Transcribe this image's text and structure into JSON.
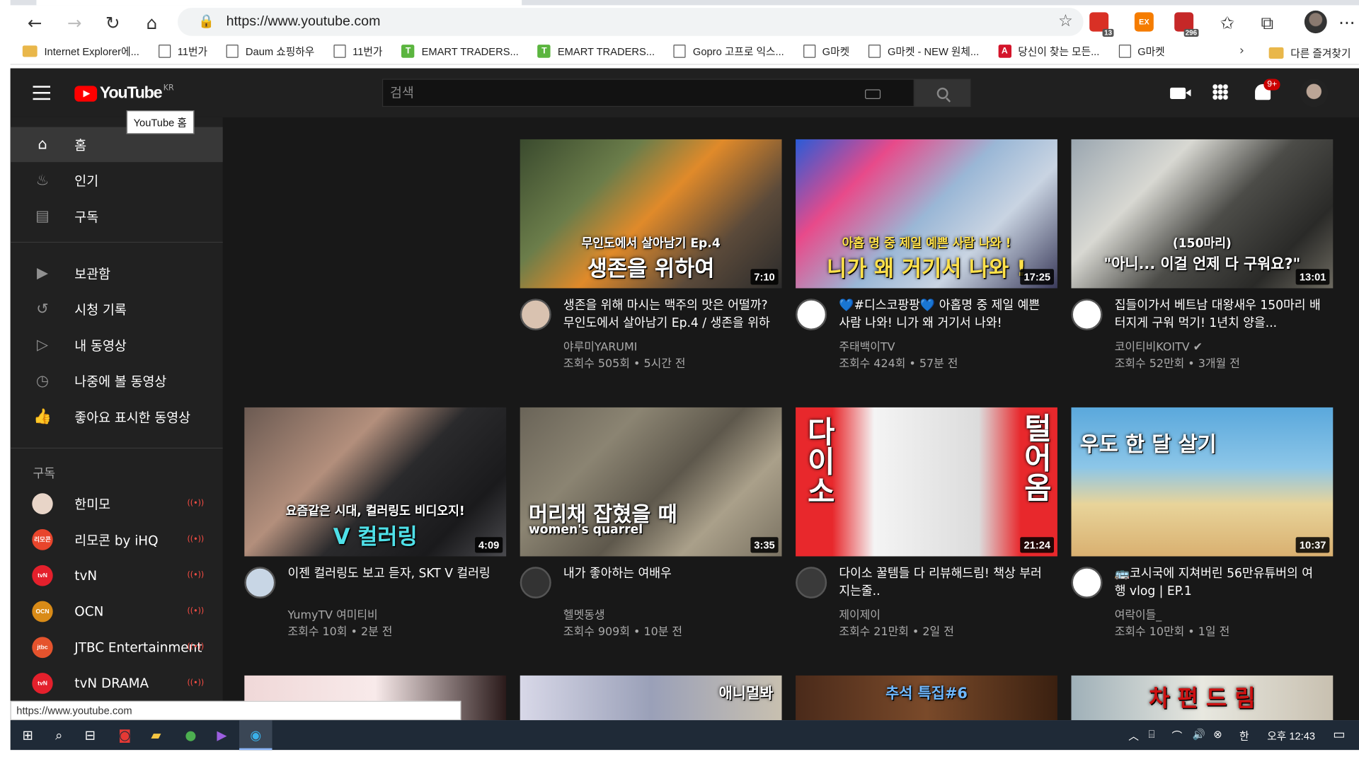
{
  "browser": {
    "url": "https://www.youtube.com",
    "status_url": "https://www.youtube.com",
    "extensions": [
      {
        "name": "adblock-icon",
        "badge": "13",
        "color": "#d93025",
        "label": ""
      },
      {
        "name": "ex-extension-icon",
        "badge": "",
        "color": "#f57c00",
        "label": "EX"
      },
      {
        "name": "calendar-extension-icon",
        "badge": "296",
        "color": "#c62828",
        "label": ""
      }
    ],
    "more_label": "···",
    "bookmarks": [
      {
        "label": "Internet Explorer에...",
        "icon": "folder"
      },
      {
        "label": "11번가",
        "icon": "page"
      },
      {
        "label": "Daum 쇼핑하우",
        "icon": "page"
      },
      {
        "label": "11번가",
        "icon": "page"
      },
      {
        "label": "EMART TRADERS...",
        "icon": "green"
      },
      {
        "label": "EMART TRADERS...",
        "icon": "green"
      },
      {
        "label": "Gopro 고프로 익스...",
        "icon": "page"
      },
      {
        "label": "G마켓",
        "icon": "page"
      },
      {
        "label": "G마켓 - NEW 원체...",
        "icon": "page"
      },
      {
        "label": "당신이 찾는 모든...",
        "icon": "red"
      },
      {
        "label": "G마켓",
        "icon": "page"
      }
    ],
    "other_bookmarks": "다른 즐겨찾기"
  },
  "youtube": {
    "logo_text": "YouTube",
    "logo_region": "KR",
    "tooltip": "YouTube 홈",
    "search_placeholder": "검색",
    "notification_badge": "9+",
    "sidebar": {
      "main": [
        {
          "label": "홈",
          "icon": "home-icon",
          "glyph": "⌂",
          "active": true
        },
        {
          "label": "인기",
          "icon": "fire-icon",
          "glyph": "♨",
          "active": false
        },
        {
          "label": "구독",
          "icon": "subscriptions-icon",
          "glyph": "▤",
          "active": false
        }
      ],
      "library": [
        {
          "label": "보관함",
          "icon": "library-icon",
          "glyph": "▶"
        },
        {
          "label": "시청 기록",
          "icon": "history-icon",
          "glyph": "↺"
        },
        {
          "label": "내 동영상",
          "icon": "my-videos-icon",
          "glyph": "▷"
        },
        {
          "label": "나중에 볼 동영상",
          "icon": "watch-later-icon",
          "glyph": "◷"
        },
        {
          "label": "좋아요 표시한 동영상",
          "icon": "thumbs-up-icon",
          "glyph": "👍"
        }
      ],
      "subs_title": "구독",
      "subscriptions": [
        {
          "label": "한미모",
          "color": "#e8d5c8",
          "initials": ""
        },
        {
          "label": "리모콘 by iHQ",
          "color": "#e8452c",
          "initials": "리모콘"
        },
        {
          "label": "tvN",
          "color": "#e4202c",
          "initials": "tvN"
        },
        {
          "label": "OCN",
          "color": "#d98b17",
          "initials": "OCN"
        },
        {
          "label": "JTBC Entertainment",
          "color": "#e5532d",
          "initials": "jtbc"
        },
        {
          "label": "tvN DRAMA",
          "color": "#e4202c",
          "initials": "tvN"
        }
      ]
    },
    "videos": [
      {
        "title": "생존을 위해 마시는 맥주의 맛은 어떨까? 무인도에서 살아남기 Ep.4 / 생존을 위하여",
        "channel": "야루미YARUMI",
        "meta": "조회수 505회 • 5시간 전",
        "duration": "7:10",
        "cap_small": "무인도에서 살아남기 Ep.4",
        "cap_big": "생존을 위하여",
        "cap_color": "#ffffff",
        "bg": "linear-gradient(135deg,#3a4a2e 0%,#6b7d4a 30%,#e08a2a 50%,#5b4a3a 75%,#2b2b2b 100%)",
        "avatar": "#d9c2b0",
        "verified": false
      },
      {
        "title": "💙#디스코팡팡💙 아홉명 중 제일 예쁜 사람 나와! 니가 왜 거기서 나와!",
        "channel": "주태백이TV",
        "meta": "조회수 424회 • 57분 전",
        "duration": "17:25",
        "cap_small": "아홉 명 중 제일 예쁜 사람 나와 !",
        "cap_big": "니가 왜 거기서 나와 !",
        "cap_color": "#ffe14a",
        "bg": "linear-gradient(135deg,#2a5bd7 0%,#e84a8a 25%,#9ab7d6 50%,#c9d4e2 70%,#3a3a5a 100%)",
        "avatar": "#ffffff",
        "verified": false
      },
      {
        "title": "집들이가서 베트남 대왕새우 150마리 배터지게 구워 먹기! 1년치 양을...",
        "channel": "코이티비KOITV",
        "meta": "조회수 52만회 • 3개월 전",
        "duration": "13:01",
        "cap_small": "(150마리)",
        "cap_big": "\"아니... 이걸 언제 다 구워요?\"",
        "cap_color": "#ffffff",
        "bg": "linear-gradient(135deg,#9aa6b0 0%,#d8d8d2 30%,#4c4c48 55%,#2a2a28 80%,#6d6a60 100%)",
        "avatar": "#ffffff",
        "verified": true
      },
      {
        "title": "이젠 컬러링도 보고 듣자, SKT V 컬러링",
        "channel": "YumyTV 여미티비",
        "meta": "조회수 10회 • 2분 전",
        "duration": "4:09",
        "cap_small": "요즘같은 시대, 컬러링도 비디오지!",
        "cap_big": "V 컬러링",
        "cap_color": "#4fe0e8",
        "bg": "linear-gradient(135deg,#6b5a52 0%,#b38f7c 35%,#2a2a2c 55%,#1a1a1c 80%,#4a4a4e 100%)",
        "avatar": "#c8d6e5",
        "verified": false
      },
      {
        "title": "내가 좋아하는 여배우",
        "channel": "헬멧동생",
        "meta": "조회수 909회 • 10분 전",
        "duration": "3:35",
        "cap_small": "",
        "cap_big": "머리채 잡혔을 때",
        "cap_sub": "women's quarrel",
        "cap_color": "#ffffff",
        "bg": "linear-gradient(135deg,#6a6458 0%,#8b8472 30%,#5e584c 55%,#aaa08a 75%,#7a7262 100%)",
        "avatar": "#333333",
        "verified": false
      },
      {
        "title": "다이소 꿀템들 다 리뷰해드림! 책상 부러지는줄..",
        "channel": "제이제이",
        "meta": "조회수 21만회 • 2일 전",
        "duration": "21:24",
        "cap_small": "",
        "cap_big": "",
        "cap_left": "다이소",
        "cap_right": "털어옴",
        "cap_color": "#ffffff",
        "bg": "linear-gradient(90deg,#e8282c 0%,#e8282c 14%,#f4f4f4 30%,#dcdcdc 70%,#e8282c 86%,#e8282c 100%)",
        "avatar": "#3a3a3a",
        "verified": false
      },
      {
        "title": "🚌코시국에 지쳐버린 56만유튜버의 여행 vlog | EP.1",
        "channel": "여락이들_",
        "meta": "조회수 10만회 • 1일 전",
        "duration": "10:37",
        "cap_small": "",
        "cap_big": "우도 한 달 살기",
        "cap_color": "#ffffff",
        "bg": "linear-gradient(180deg,#5aa8dc 0%,#8cc6e8 40%,#e8d49a 65%,#d9b070 100%)",
        "avatar": "#ffffff",
        "verified": false
      }
    ],
    "partial_row": [
      {
        "bg": "linear-gradient(90deg,#f0d8d8 0%,#f8eaea 50%,#2a1a1a 100%)",
        "cap": ""
      },
      {
        "bg": "linear-gradient(90deg,#d8d8e8 0%,#9aa0b8 50%,#c8c0b0 100%)",
        "cap": "애니멀봐"
      },
      {
        "bg": "linear-gradient(90deg,#4a2a1a 0%,#7a4a2a 50%,#3a2010 100%)",
        "cap": "추석 특집#6"
      },
      {
        "bg": "linear-gradient(90deg,#9fb0b8 0%,#e8e8e0 50%,#c8c0b0 100%)",
        "cap": "차 편 드 림"
      }
    ]
  },
  "taskbar": {
    "ime": "한",
    "time": "오후 12:43"
  }
}
